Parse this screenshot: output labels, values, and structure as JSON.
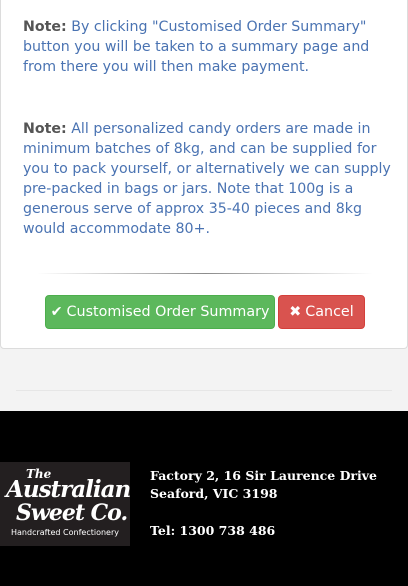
{
  "notes": [
    {
      "label": "Note:",
      "text": "By clicking \"Customised Order Summary\" button you will be taken to a summary page and from there you will then make payment."
    },
    {
      "label": "Note:",
      "text": "All personalized candy orders are made in minimum batches of 8kg, and can be supplied for you to pack yourself, or alternatively we can supply pre-packed in bags or jars. Note that 100g is a generous serve of approx 35-40 pieces and 8kg would accommodate 80+."
    }
  ],
  "buttons": {
    "summary_label": "Customised Order Summary",
    "summary_icon": "check-icon",
    "cancel_label": "Cancel",
    "cancel_icon": "times-icon"
  },
  "footer": {
    "logo": {
      "line1": "The",
      "line2": "Australian",
      "line3": "Sweet Co.",
      "tagline": "Handcrafted Confectionery"
    },
    "address_line1": "Factory 2, 16 Sir Laurence Drive",
    "address_line2": "Seaford, VIC 3198",
    "tel": "Tel: 1300 738 486"
  },
  "colors": {
    "note_text": "#4a73b2",
    "success": "#5cb85c",
    "danger": "#d9534f",
    "footer_bg": "#000000"
  }
}
